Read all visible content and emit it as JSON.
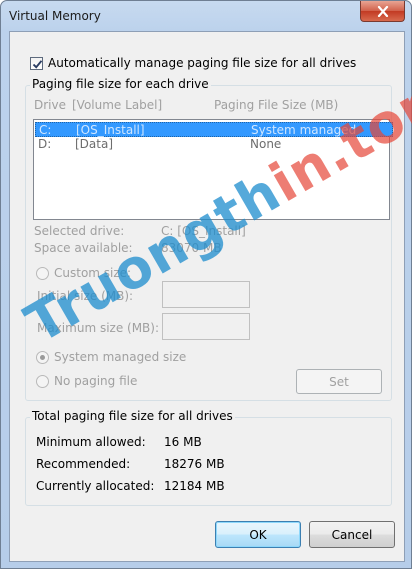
{
  "window": {
    "title": "Virtual Memory",
    "close_icon": "close-icon"
  },
  "auto_manage": {
    "label": "Automatically manage paging file size for all drives",
    "checked": true
  },
  "paging_group": {
    "title": "Paging file size for each drive",
    "columns": {
      "drive": "Drive",
      "volume": "[Volume Label]",
      "size": "Paging File Size (MB)"
    },
    "rows": [
      {
        "drive": "C:",
        "label": "[OS_Install]",
        "size": "System managed",
        "selected": true
      },
      {
        "drive": "D:",
        "label": "[Data]",
        "size": "None",
        "selected": false
      }
    ],
    "selected_drive_label": "Selected drive:",
    "selected_drive_value": "C:  [OS_Install]",
    "space_available_label": "Space available:",
    "space_available_value": "83070 MB",
    "custom_size_label": "Custom size:",
    "initial_size_label": "Initial size (MB):",
    "initial_size_value": "",
    "maximum_size_label": "Maximum size (MB):",
    "maximum_size_value": "",
    "system_managed_label": "System managed size",
    "no_paging_label": "No paging file",
    "set_button": "Set"
  },
  "total_group": {
    "title": "Total paging file size for all drives",
    "minimum_label": "Minimum allowed:",
    "minimum_value": "16 MB",
    "recommended_label": "Recommended:",
    "recommended_value": "18276 MB",
    "allocated_label": "Currently allocated:",
    "allocated_value": "12184 MB"
  },
  "buttons": {
    "ok": "OK",
    "cancel": "Cancel"
  },
  "watermark": {
    "part_a": "Truongth",
    "part_b": "in.top"
  }
}
